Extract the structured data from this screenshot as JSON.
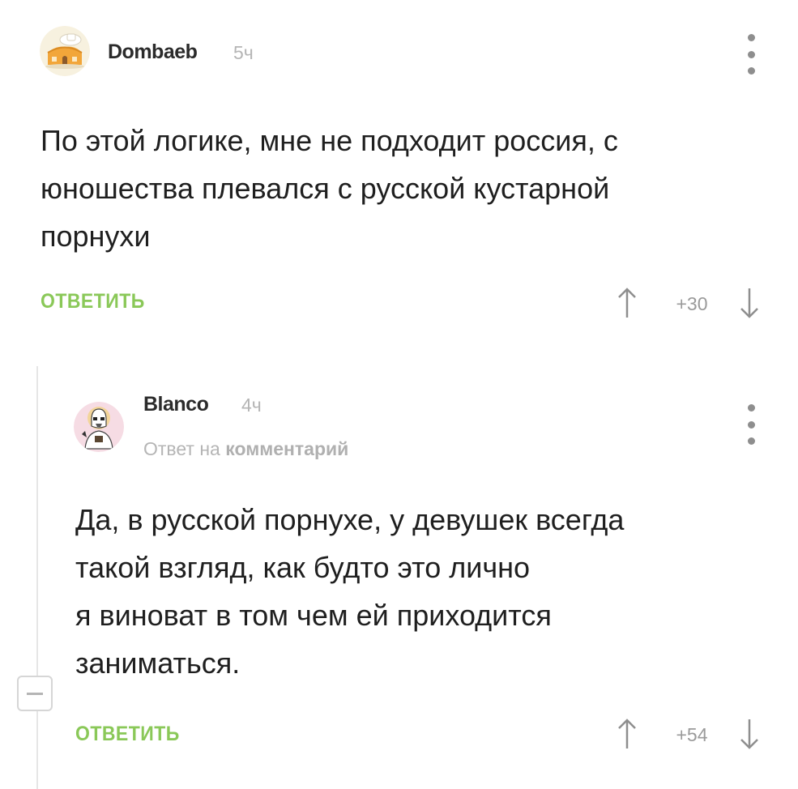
{
  "comments": [
    {
      "username": "Dombaeb",
      "time": "5ч",
      "text": "По этой логике, мне не подходит россия, с\nюношества плевался с русской кустарной\nпорнухи",
      "reply_label": "ОТВЕТИТЬ",
      "rating": "+30",
      "avatar_icon": "cartoon-house-avatar"
    },
    {
      "username": "Blanco",
      "time": "4ч",
      "reply_prefix": "Ответ на",
      "reply_target": "комментарий",
      "text": "Да, в русской порнухе, у девушек всегда\nтакой взгляд, как будто это лично\nя виноват в том чем ей приходится\nзаниматься.",
      "reply_label": "ОТВЕТИТЬ",
      "rating": "+54",
      "avatar_icon": "stormtrooper-avatar"
    }
  ],
  "colors": {
    "accent_green": "#8ac858",
    "muted_gray": "#b5b5b5",
    "text": "#1f1f1f"
  },
  "icons": {
    "menu": "more-vertical-icon",
    "upvote": "arrow-up-icon",
    "downvote": "arrow-down-icon",
    "collapse": "minus-box-icon"
  }
}
